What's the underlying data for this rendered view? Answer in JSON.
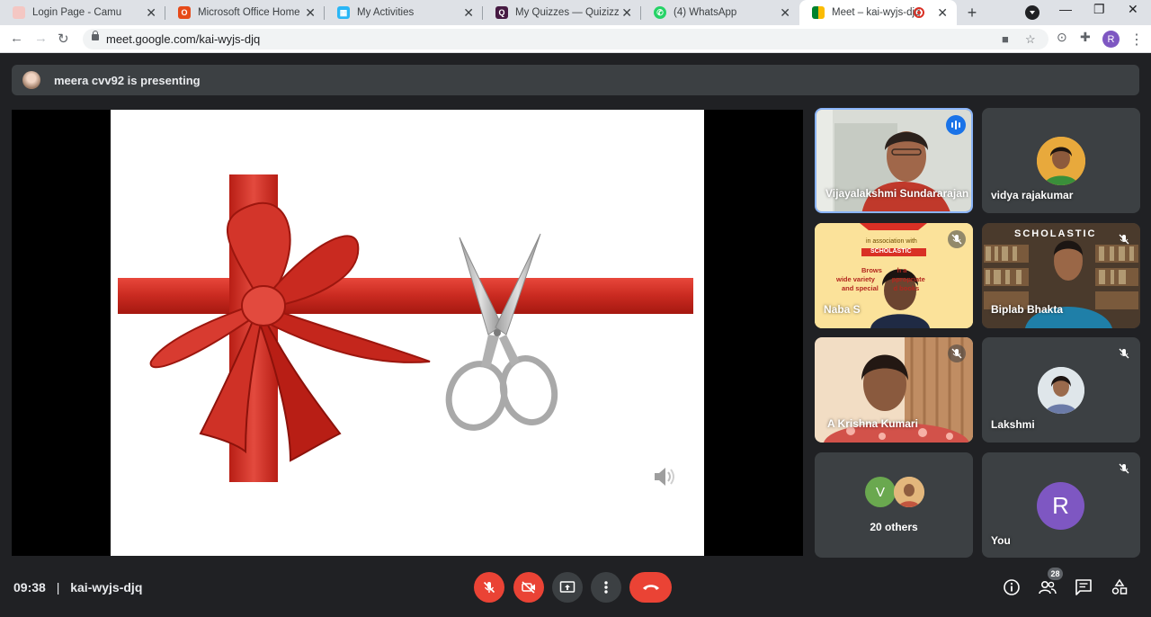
{
  "browser": {
    "tabs": [
      {
        "title": "Login Page - Camu",
        "active": false
      },
      {
        "title": "Microsoft Office Home",
        "active": false
      },
      {
        "title": "My Activities",
        "active": false
      },
      {
        "title": "My Quizzes — Quizizz",
        "active": false
      },
      {
        "title": "(4) WhatsApp",
        "active": false
      },
      {
        "title": "Meet – kai-wyjs-djq",
        "active": true
      }
    ],
    "url": "meet.google.com/kai-wyjs-djq",
    "profile_initial": "R"
  },
  "meet": {
    "presenting_text": "meera cvv92 is presenting",
    "participants": [
      {
        "name": "Vijayalakshmi Sundararajan",
        "speaking": true
      },
      {
        "name": "vidya rajakumar",
        "muted": false
      },
      {
        "name": "Naba S",
        "muted": true
      },
      {
        "name": "Biplab Bhakta",
        "muted": true
      },
      {
        "name": "A Krishna Kumari",
        "muted": true
      },
      {
        "name": "Lakshmi",
        "muted": true
      },
      {
        "name": "20 others",
        "avatar_initial": "V"
      },
      {
        "name": "You",
        "avatar_initial": "R",
        "muted": true
      }
    ],
    "tile_text": {
      "scholastic_brand": "SCHOLASTIC",
      "assoc_line": "in association with",
      "promo_line1": "Brows        h a",
      "promo_line2": "wide variety         ppropriate",
      "promo_line3": "and special        d books"
    },
    "clock": "09:38",
    "meeting_code": "kai-wyjs-djq",
    "participant_count": "28"
  },
  "colors": {
    "accent_red": "#ea4335",
    "speaking_blue": "#1a73e8",
    "you_avatar": "#7e57c2",
    "others_avatar": "#6aa84f"
  }
}
